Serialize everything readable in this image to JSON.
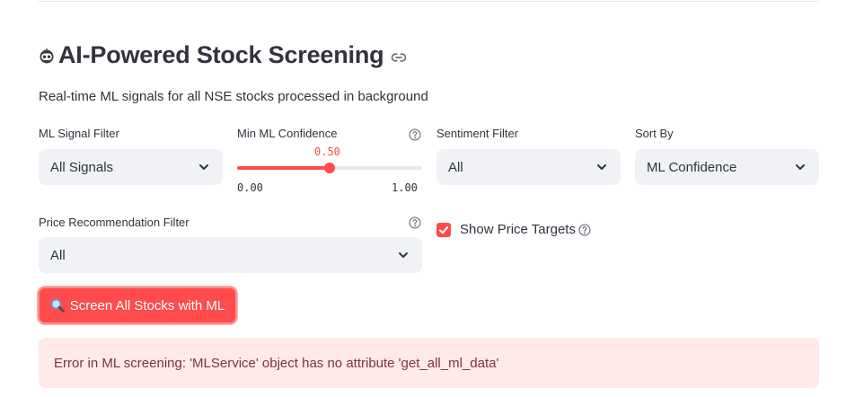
{
  "header": {
    "title": "AI-Powered Stock Screening",
    "title_icon": "robot-face-icon",
    "subtitle": "Real-time ML signals for all NSE stocks processed in background"
  },
  "filters": {
    "ml_signal": {
      "label": "ML Signal Filter",
      "value": "All Signals"
    },
    "min_confidence": {
      "label": "Min ML Confidence",
      "value": "0.50",
      "value_num": 0.5,
      "min": "0.00",
      "max": "1.00"
    },
    "sentiment": {
      "label": "Sentiment Filter",
      "value": "All"
    },
    "sort_by": {
      "label": "Sort By",
      "value": "ML Confidence"
    },
    "price_recommendation": {
      "label": "Price Recommendation Filter",
      "value": "All"
    },
    "show_price_targets": {
      "label": "Show Price Targets",
      "checked": true
    }
  },
  "actions": {
    "screen_button": "Screen All Stocks with ML"
  },
  "error": {
    "message": "Error in ML screening: 'MLService' object has no attribute 'get_all_ml_data'"
  },
  "colors": {
    "accent": "#ff4b4b",
    "input_bg": "#f0f2f6",
    "error_bg": "#ffe9e9",
    "error_text": "#7d353b",
    "text": "#31333f"
  }
}
